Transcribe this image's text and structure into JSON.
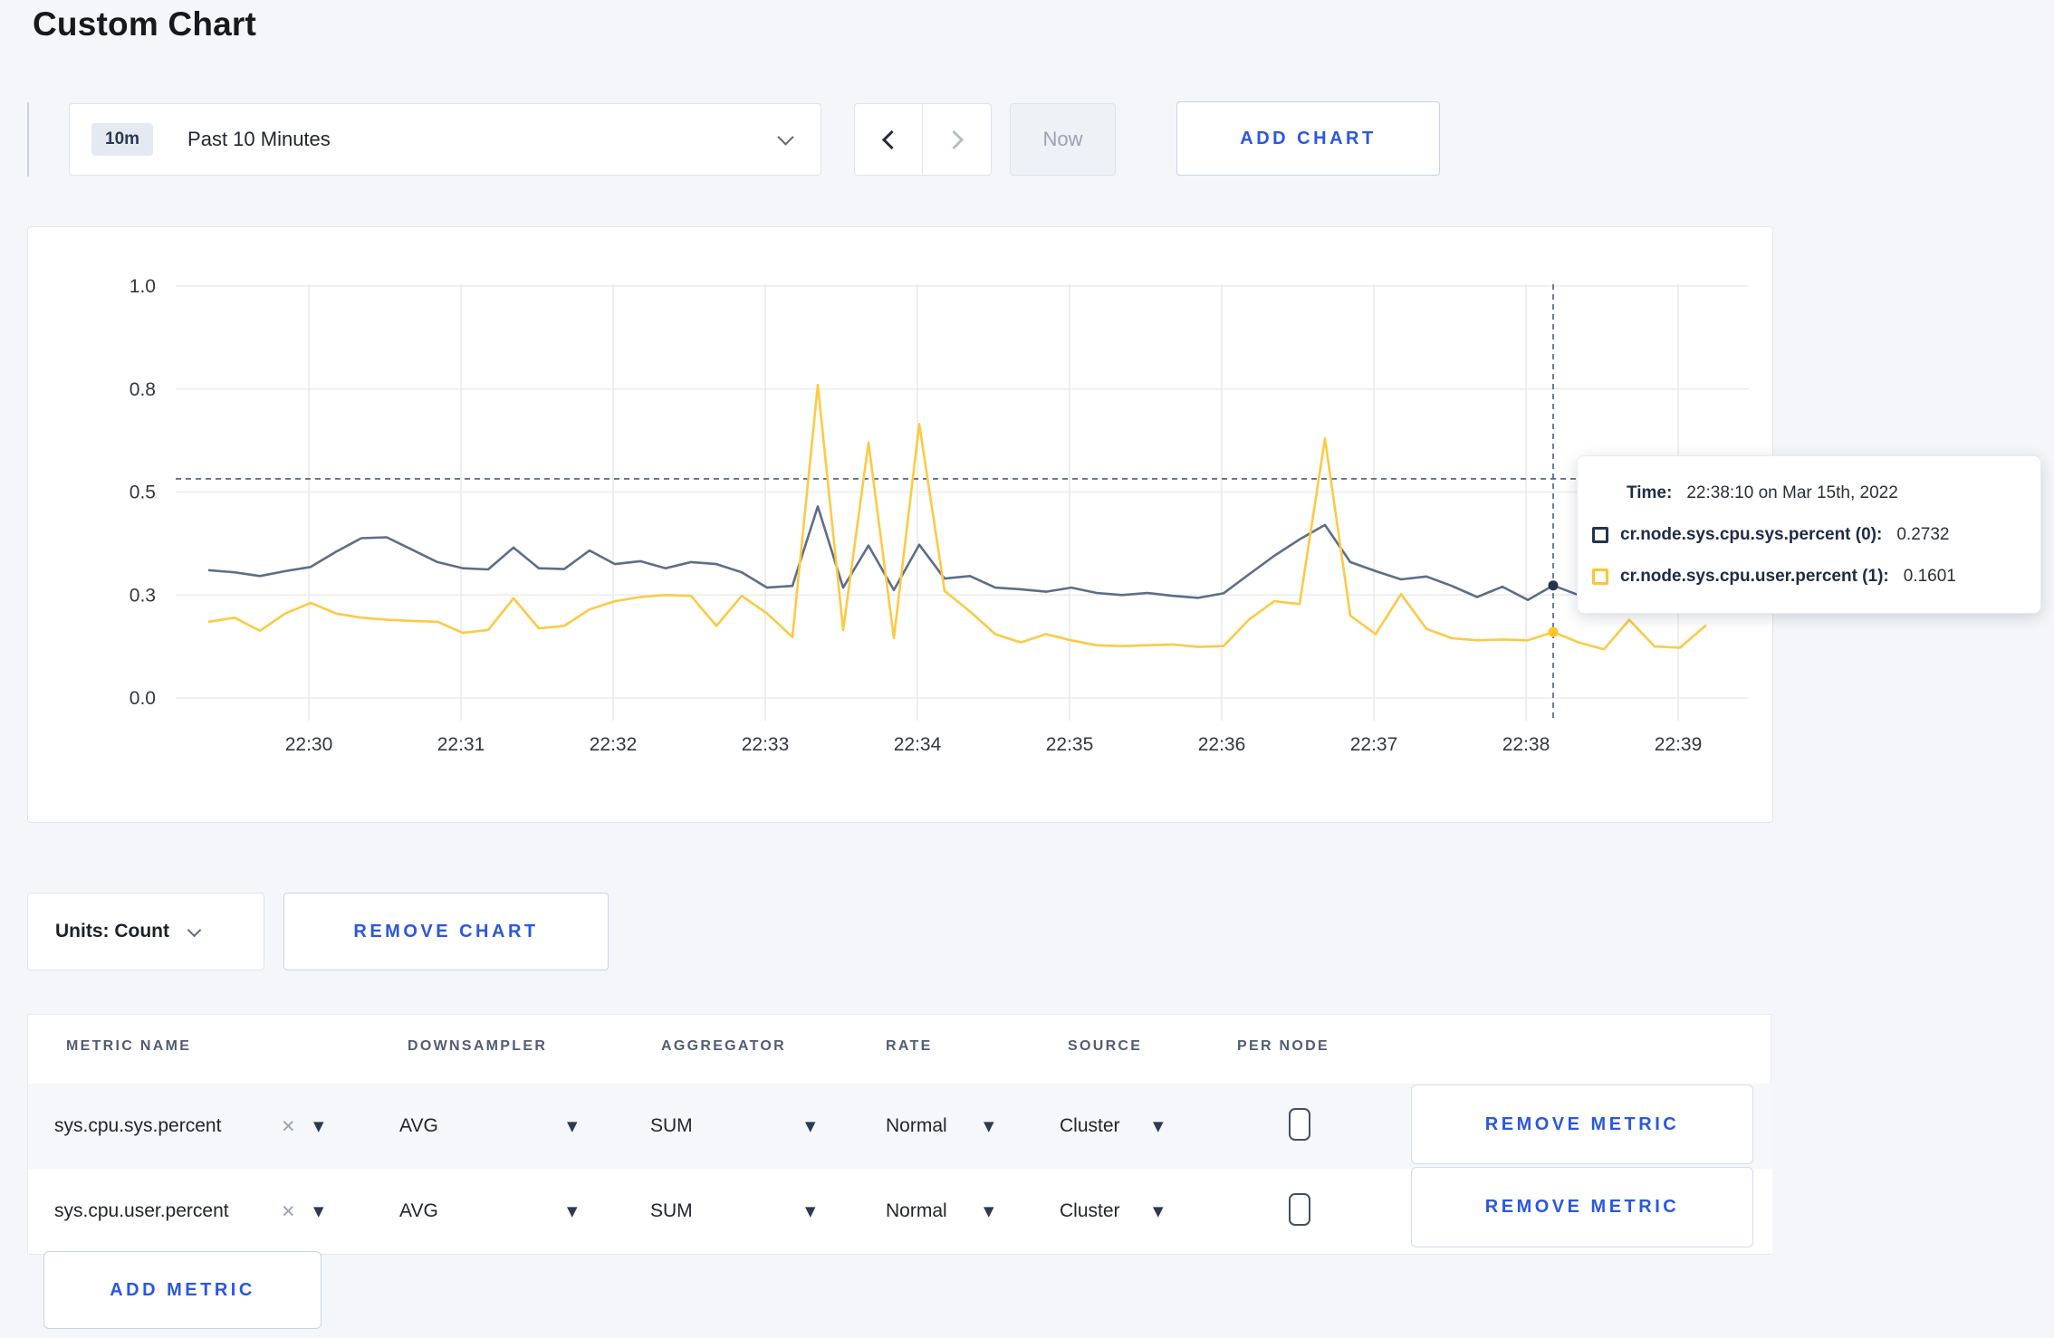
{
  "page": {
    "title": "Custom Chart"
  },
  "toolbar": {
    "time_range": {
      "badge": "10m",
      "label": "Past 10 Minutes"
    },
    "now_label": "Now",
    "add_chart_label": "ADD CHART"
  },
  "chart": {
    "units_label": "Units: Count",
    "remove_chart_label": "REMOVE CHART",
    "tooltip": {
      "time_label": "Time:",
      "time_value": "22:38:10 on Mar 15th, 2022",
      "series": [
        {
          "name": "cr.node.sys.cpu.sys.percent (0):",
          "value": "0.2732",
          "color": "#26334d"
        },
        {
          "name": "cr.node.sys.cpu.user.percent (1):",
          "value": "0.1601",
          "color": "#ffc52e"
        }
      ]
    }
  },
  "chart_data": {
    "type": "line",
    "title": "",
    "xlabel": "",
    "ylabel": "",
    "ylim": [
      0,
      1
    ],
    "grid": true,
    "x_start": "22:29:20",
    "x_step_seconds": 10,
    "x_tick_labels": [
      "22:30",
      "22:31",
      "22:32",
      "22:33",
      "22:34",
      "22:35",
      "22:36",
      "22:37",
      "22:38",
      "22:39"
    ],
    "y_ticks": [
      {
        "value": 0,
        "label": "0.0"
      },
      {
        "value": 0.25,
        "label": "0.3"
      },
      {
        "value": 0.5,
        "label": "0.5"
      },
      {
        "value": 0.75,
        "label": "0.8"
      },
      {
        "value": 1,
        "label": "1.0"
      }
    ],
    "series": [
      {
        "name": "cr.node.sys.cpu.sys.percent",
        "color": "#5c6e88",
        "values": [
          0.31,
          0.305,
          0.296,
          0.308,
          0.318,
          0.355,
          0.388,
          0.39,
          0.36,
          0.33,
          0.315,
          0.312,
          0.365,
          0.315,
          0.313,
          0.358,
          0.325,
          0.332,
          0.315,
          0.33,
          0.325,
          0.305,
          0.268,
          0.272,
          0.465,
          0.268,
          0.37,
          0.262,
          0.372,
          0.29,
          0.296,
          0.268,
          0.264,
          0.258,
          0.268,
          0.255,
          0.25,
          0.255,
          0.248,
          0.243,
          0.254,
          0.3,
          0.345,
          0.385,
          0.42,
          0.33,
          0.308,
          0.288,
          0.295,
          0.272,
          0.245,
          0.27,
          0.238,
          0.2732,
          0.25,
          0.255,
          0.26,
          0.26,
          0.258,
          0.255
        ]
      },
      {
        "name": "cr.node.sys.cpu.user.percent",
        "color": "#fcca43",
        "values": [
          0.185,
          0.195,
          0.163,
          0.205,
          0.231,
          0.205,
          0.195,
          0.19,
          0.187,
          0.185,
          0.158,
          0.165,
          0.242,
          0.169,
          0.175,
          0.215,
          0.235,
          0.245,
          0.25,
          0.248,
          0.175,
          0.248,
          0.205,
          0.148,
          0.76,
          0.165,
          0.62,
          0.145,
          0.665,
          0.26,
          0.21,
          0.155,
          0.135,
          0.155,
          0.14,
          0.128,
          0.126,
          0.128,
          0.13,
          0.124,
          0.126,
          0.19,
          0.235,
          0.228,
          0.63,
          0.2,
          0.155,
          0.252,
          0.168,
          0.145,
          0.14,
          0.142,
          0.14,
          0.1601,
          0.135,
          0.118,
          0.19,
          0.125,
          0.122,
          0.175
        ]
      }
    ],
    "crosshair": {
      "index": 53,
      "time": "22:38:10",
      "hline_value": 0.532
    }
  },
  "metrics_table": {
    "headers": [
      "METRIC NAME",
      "DOWNSAMPLER",
      "AGGREGATOR",
      "RATE",
      "SOURCE",
      "PER NODE"
    ],
    "rows": [
      {
        "metric": "sys.cpu.sys.percent",
        "downsampler": "AVG",
        "aggregator": "SUM",
        "rate": "Normal",
        "source": "Cluster",
        "per_node_checked": false,
        "remove_label": "REMOVE METRIC"
      },
      {
        "metric": "sys.cpu.user.percent",
        "downsampler": "AVG",
        "aggregator": "SUM",
        "rate": "Normal",
        "source": "Cluster",
        "per_node_checked": false,
        "remove_label": "REMOVE METRIC"
      }
    ],
    "add_metric_label": "ADD METRIC"
  }
}
